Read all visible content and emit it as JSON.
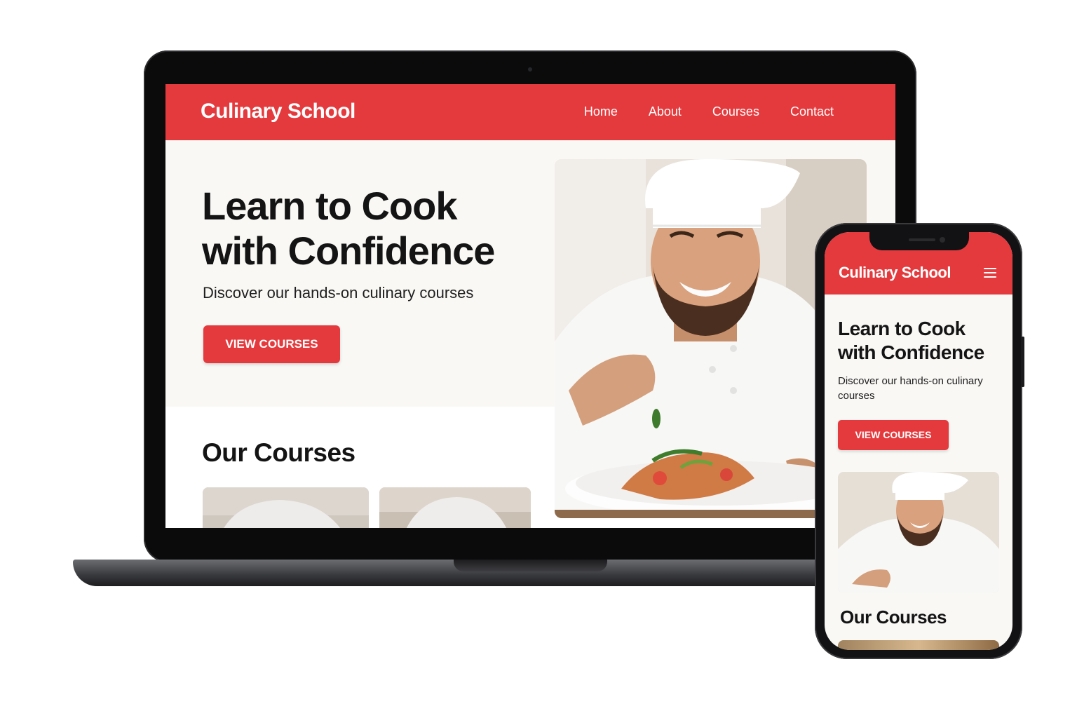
{
  "brand": "Culinary School",
  "nav": {
    "links": [
      "Home",
      "About",
      "Courses",
      "Contact"
    ]
  },
  "hero": {
    "title_line1": "Learn to Cook",
    "title_line2": "with Confidence",
    "subtitle": "Discover our hands-on culinary courses",
    "cta": "VIEW COURSES"
  },
  "courses": {
    "title": "Our Courses"
  },
  "colors": {
    "accent": "#e53a3d",
    "background": "#faf8f5",
    "text": "#141414"
  },
  "icons": {
    "menu": "hamburger-menu-icon"
  }
}
